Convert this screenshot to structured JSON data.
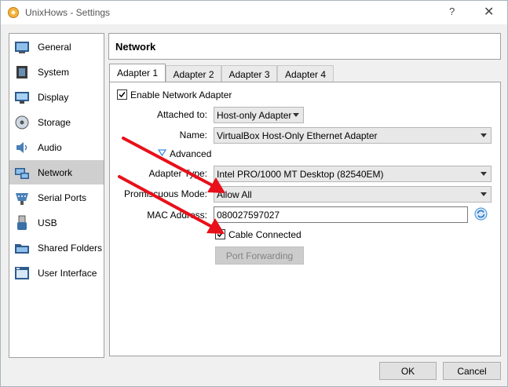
{
  "window": {
    "title": "UnixHows - Settings",
    "help": "?",
    "close": "✕"
  },
  "sidebar": {
    "items": [
      {
        "label": "General",
        "icon": "general-icon"
      },
      {
        "label": "System",
        "icon": "system-icon"
      },
      {
        "label": "Display",
        "icon": "display-icon"
      },
      {
        "label": "Storage",
        "icon": "storage-icon"
      },
      {
        "label": "Audio",
        "icon": "audio-icon"
      },
      {
        "label": "Network",
        "icon": "network-icon",
        "active": true
      },
      {
        "label": "Serial Ports",
        "icon": "serial-ports-icon"
      },
      {
        "label": "USB",
        "icon": "usb-icon"
      },
      {
        "label": "Shared Folders",
        "icon": "shared-folders-icon"
      },
      {
        "label": "User Interface",
        "icon": "user-interface-icon"
      }
    ]
  },
  "page": {
    "title": "Network"
  },
  "tabs": [
    "Adapter 1",
    "Adapter 2",
    "Adapter 3",
    "Adapter 4"
  ],
  "adapter": {
    "enable_label": "Enable Network Adapter",
    "enable_checked": true,
    "attached_label": "Attached to:",
    "attached_value": "Host-only Adapter",
    "name_label": "Name:",
    "name_value": "VirtualBox Host-Only Ethernet Adapter",
    "advanced_label": "Advanced",
    "adapter_type_label": "Adapter Type:",
    "adapter_type_value": "Intel PRO/1000 MT Desktop (82540EM)",
    "promiscuous_label": "Promiscuous Mode:",
    "promiscuous_value": "Allow All",
    "mac_label": "MAC Address:",
    "mac_value": "080027597027",
    "cable_label": "Cable Connected",
    "cable_checked": true,
    "port_forwarding_label": "Port Forwarding"
  },
  "footer": {
    "ok": "OK",
    "cancel": "Cancel"
  },
  "colors": {
    "annotation_arrow": "#e8101a",
    "selected_item": "#cfcfcf",
    "accent_blue": "#3c8ddc"
  }
}
